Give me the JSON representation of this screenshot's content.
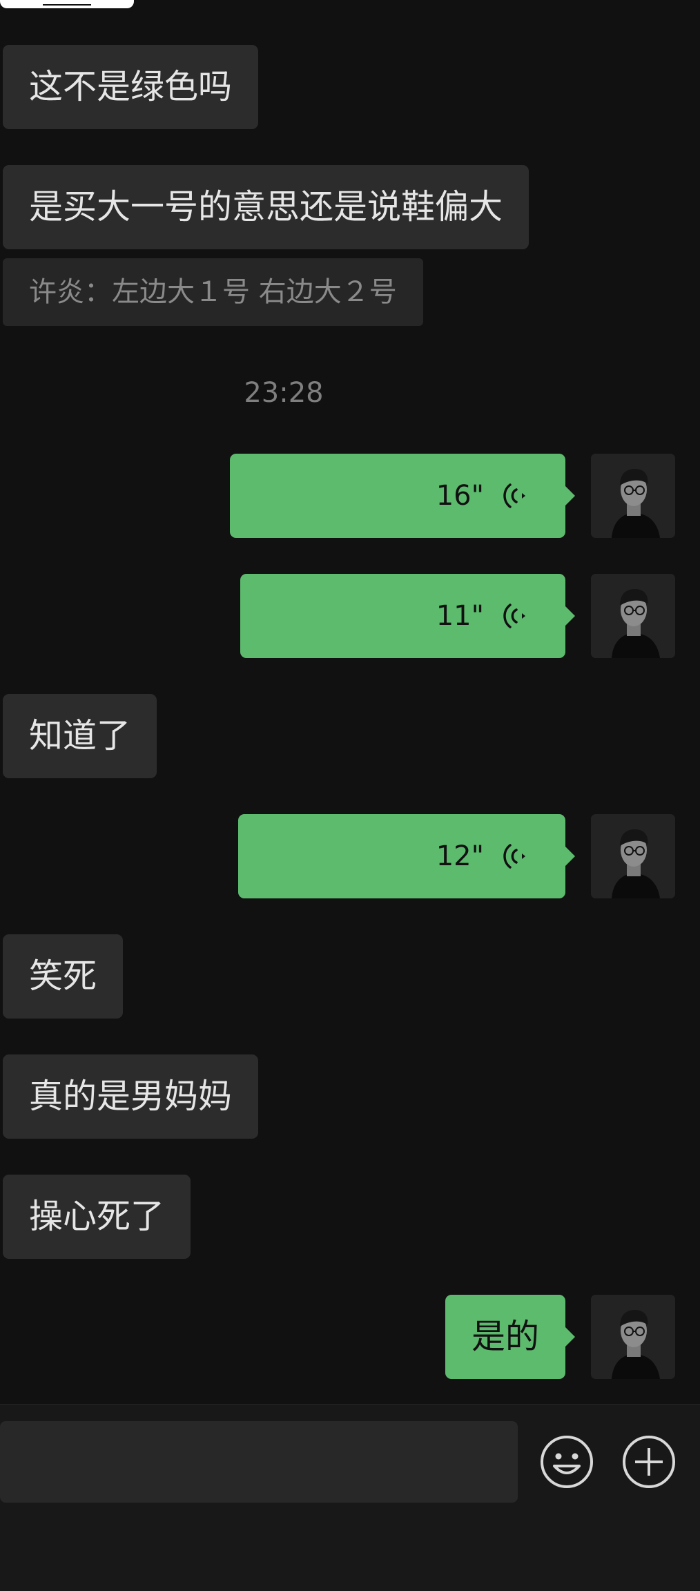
{
  "messages": {
    "m1": "这不是绿色吗",
    "m2": "是买大一号的意思还是说鞋偏大",
    "quote": "许炎：左边大１号 右边大２号",
    "time": "23:28",
    "v1": "16\"",
    "v2": "11\"",
    "m3": "知道了",
    "v3": "12\"",
    "m4": "笑死",
    "m5": "真的是男妈妈",
    "m6": "操心死了",
    "m7": "是的"
  },
  "icons": {
    "voice": "voice-wave-icon",
    "emoji": "emoji-icon",
    "plus": "plus-icon"
  },
  "colors": {
    "background": "#111111",
    "incoming_bubble": "#2c2c2c",
    "outgoing_bubble": "#5dbb6e",
    "timestamp": "#7f7f7f"
  }
}
